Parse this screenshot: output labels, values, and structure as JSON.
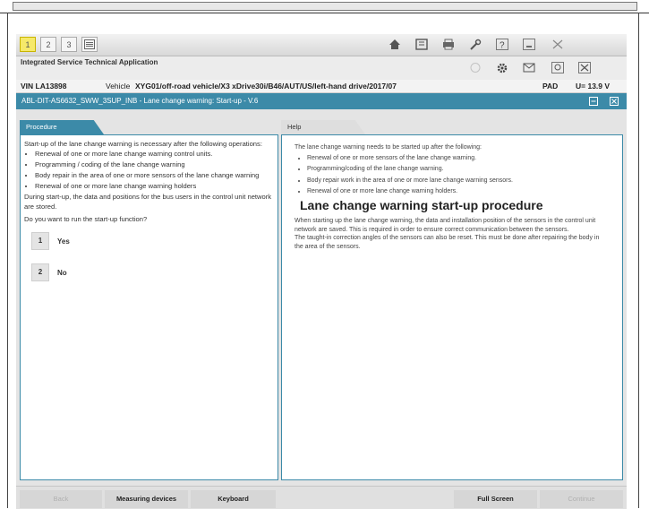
{
  "toolbar": {
    "left_buttons": [
      "1",
      "2",
      "3"
    ],
    "right_icons": [
      "home-icon",
      "book-icon",
      "printer-icon",
      "wrench-icon",
      "help-icon",
      "minimize-icon",
      "close-icon"
    ]
  },
  "titlebar": {
    "app_title": "Integrated Service Technical Application",
    "icons": [
      "disabled-icon",
      "gear-icon",
      "mail-icon",
      "scan-icon",
      "close-icon"
    ]
  },
  "vinbar": {
    "vin": "VIN  LA13898",
    "vehicle_label": "Vehicle",
    "vehicle_value": "XYG01/off-road vehicle/X3 xDrive30i/B46/AUT/US/left-hand drive/2017/07",
    "pad": "PAD",
    "voltage": "U=  13.9 V"
  },
  "bluebar": {
    "title": "ABL-DIT-AS6632_SWW_3SUP_INB - Lane change warning: Start-up - V.6"
  },
  "tabs": {
    "procedure": "Procedure",
    "help": "Help"
  },
  "procedure": {
    "intro": "Start-up of the lane change warning is necessary after the following operations:",
    "items": [
      "Renewal of one or more lane change warning control units.",
      "Programming / coding of the lane change warning",
      "Body repair in the area of one or more sensors of the lane change warning",
      "Renewal of one or more lane change warning holders"
    ],
    "note": "During start-up, the data and positions for the bus users in the control unit network are stored.",
    "question": "Do you want to run the start-up function?",
    "choices": [
      {
        "num": "1",
        "label": "Yes"
      },
      {
        "num": "2",
        "label": "No"
      }
    ]
  },
  "help": {
    "intro": "The lane change warning needs to be started up after the following:",
    "items": [
      "Renewal of one or more sensors of the lane change warning.",
      "Programming/coding of the lane change warning.",
      "Body repair work in the area of one or more lane change warning sensors.",
      "Renewal of one or more lane change warning holders."
    ],
    "heading": "Lane change warning start-up procedure",
    "para1": "When starting up the lane change warning, the data and installation position of the sensors in the control unit network are saved. This is required in order to ensure correct communication between the sensors.",
    "para2": "The taught-in correction angles of the sensors can also be reset. This must be done after repairing the body in the area of the sensors."
  },
  "bottombar": {
    "back": "Back",
    "measuring": "Measuring devices",
    "keyboard": "Keyboard",
    "fullscreen": "Full Screen",
    "continue": "Continue"
  }
}
